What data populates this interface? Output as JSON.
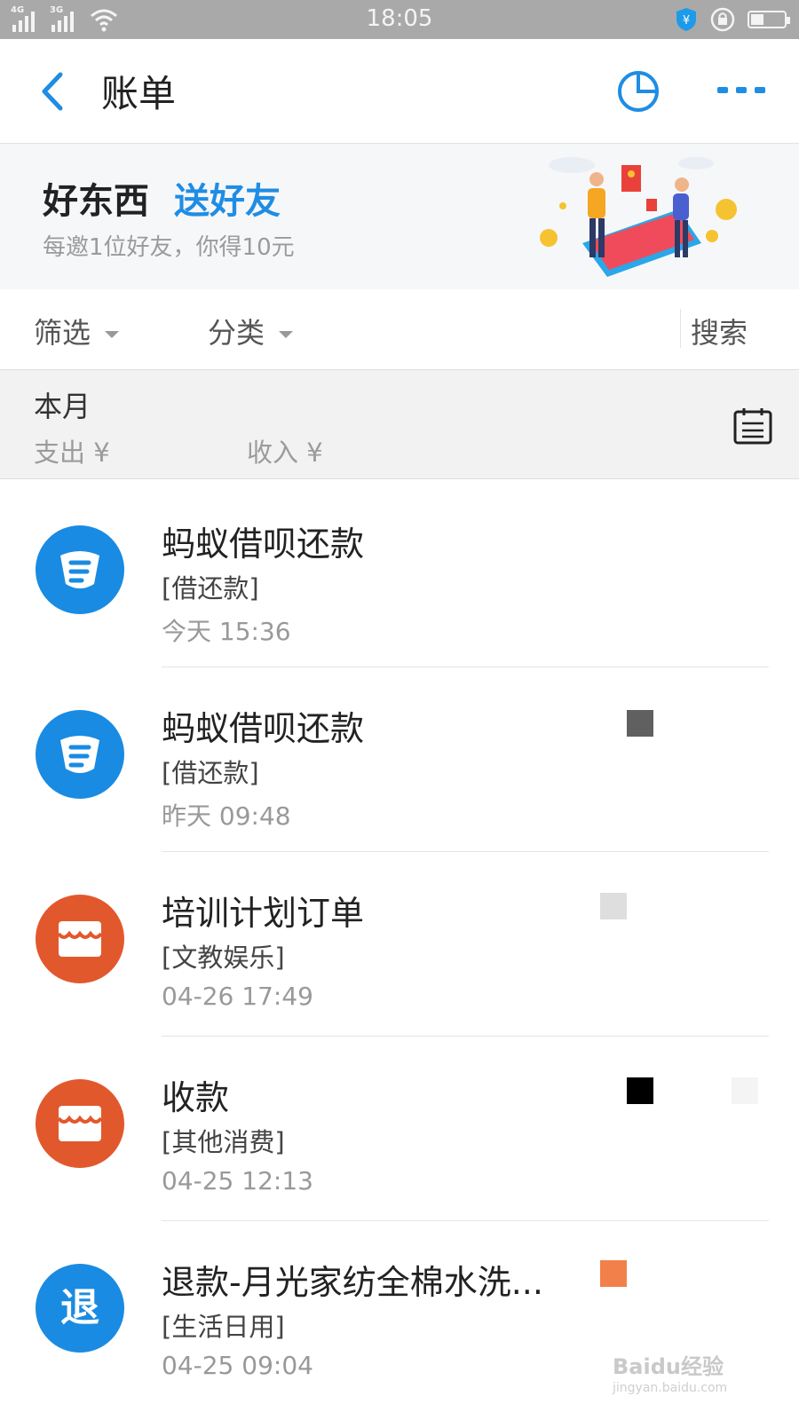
{
  "status_bar": {
    "net1": "4G",
    "net2": "3G",
    "time": "18:05"
  },
  "header": {
    "title": "账单",
    "back_icon": "chevron-left-icon",
    "stats_icon": "pie-chart-icon",
    "more_icon": "more-dots-icon"
  },
  "banner": {
    "title_part1": "好东西",
    "title_part2": "送好友",
    "subtitle": "每邀1位好友，你得10元"
  },
  "filters": {
    "filter_label": "筛选",
    "category_label": "分类",
    "search_label": "搜索"
  },
  "month": {
    "title": "本月",
    "expense_label": "支出 ¥",
    "income_label": "收入 ¥"
  },
  "transactions": [
    {
      "name": "蚂蚁借呗还款",
      "category": "[借还款]",
      "time": "今天  15:36",
      "icon": "jiebei-icon",
      "color": "#1a8be2"
    },
    {
      "name": "蚂蚁借呗还款",
      "category": "[借还款]",
      "time": "昨天  09:48",
      "icon": "jiebei-icon",
      "color": "#1a8be2"
    },
    {
      "name": "培训计划订单",
      "category": "[文教娱乐]",
      "time": "04-26  17:49",
      "icon": "shop-icon",
      "color": "#e2582d"
    },
    {
      "name": "收款",
      "category": "[其他消费]",
      "time": "04-25  12:13",
      "icon": "shop-icon",
      "color": "#e2582d"
    },
    {
      "name": "退款-月光家纺全棉水洗...",
      "category": "[生活日用]",
      "time": "04-25  09:04",
      "icon": "refund-icon",
      "icon_text": "退",
      "color": "#1a8be2"
    }
  ],
  "watermark": {
    "logo": "Baidu经验",
    "url": "jingyan.baidu.com"
  }
}
